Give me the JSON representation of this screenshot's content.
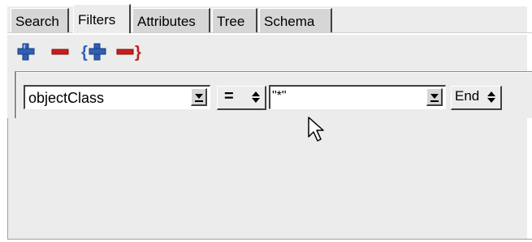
{
  "tabs": [
    {
      "label": "Search",
      "active": false
    },
    {
      "label": "Filters",
      "active": true
    },
    {
      "label": "Attributes",
      "active": false
    },
    {
      "label": "Tree",
      "active": false
    },
    {
      "label": "Schema",
      "active": false
    }
  ],
  "toolbar": {
    "icons": [
      "add-icon",
      "remove-icon",
      "add-group-icon",
      "remove-group-icon"
    ],
    "colors": {
      "add": "#2f5fb5",
      "remove": "#c81e1e"
    }
  },
  "filter_row": {
    "attribute": {
      "value": "objectClass"
    },
    "operator": {
      "value": "="
    },
    "filter_value": {
      "value": "\"*\""
    },
    "conjunction": {
      "value": "End"
    }
  }
}
